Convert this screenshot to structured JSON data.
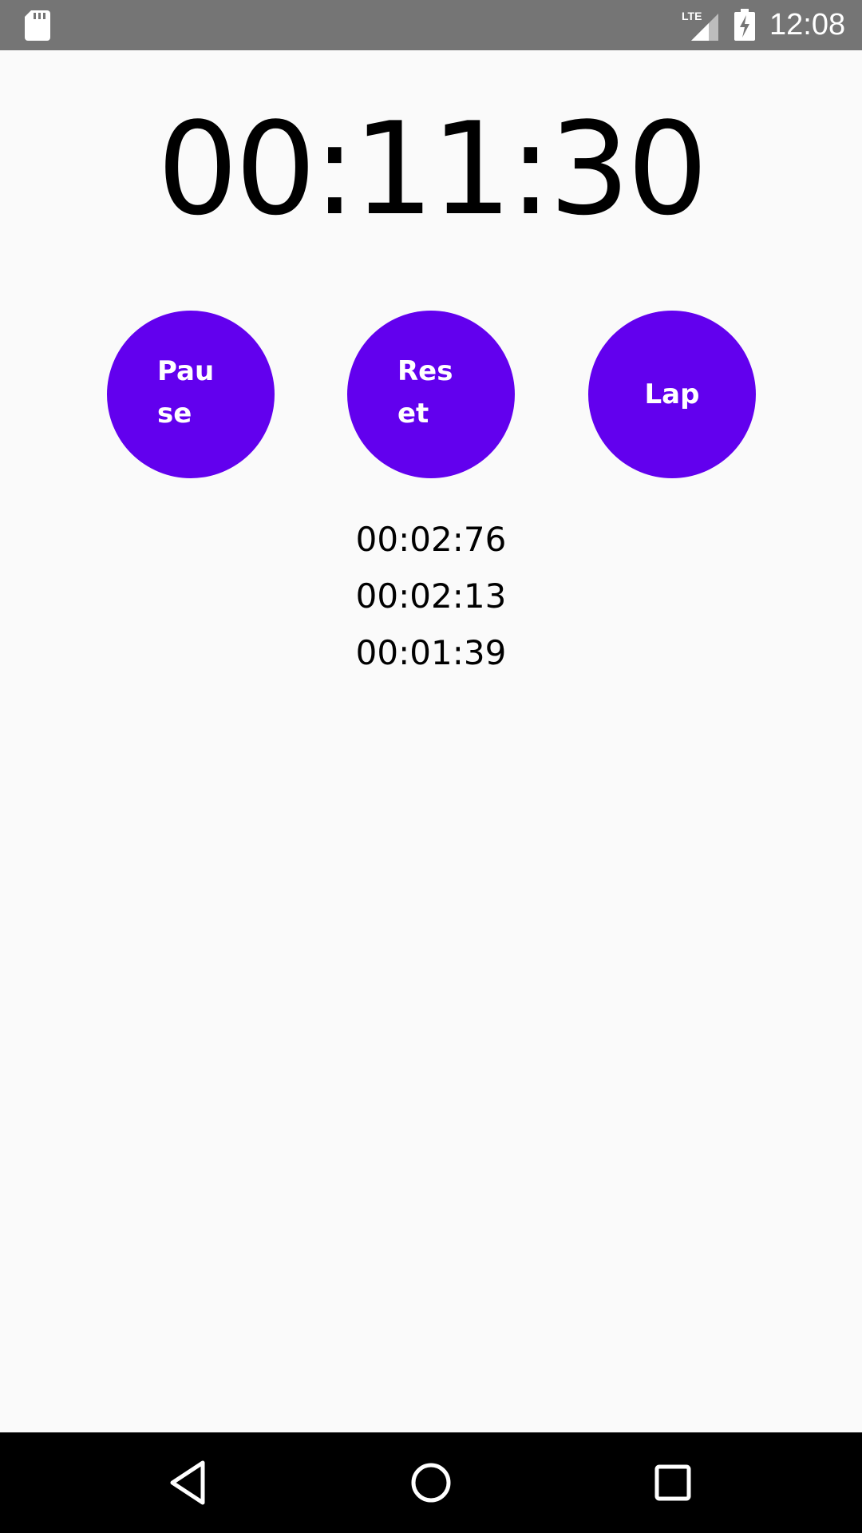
{
  "status_bar": {
    "time": "12:08",
    "network": "LTE",
    "icons": [
      "sd-card-icon",
      "lte-signal-icon",
      "battery-charging-icon"
    ]
  },
  "stopwatch": {
    "elapsed": "00:11:30"
  },
  "buttons": {
    "pause_label": "Pause",
    "reset_label": "Reset",
    "lap_label": "Lap"
  },
  "laps": [
    "00:02:76",
    "00:02:13",
    "00:01:39"
  ],
  "nav_bar": {
    "icons": [
      "back-icon",
      "home-icon",
      "recents-icon"
    ]
  },
  "colors": {
    "accent": "#6200ee",
    "background": "#fafafa",
    "status_bar": "#757575",
    "nav_bar": "#000000"
  }
}
